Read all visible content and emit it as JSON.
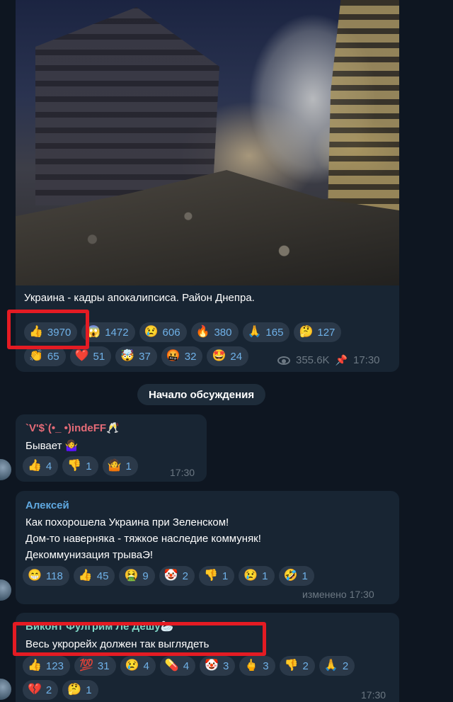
{
  "post": {
    "caption": "Украина - кадры апокалипсиса. Район Днепра.",
    "reactions": [
      {
        "emoji": "👍",
        "count": "3970"
      },
      {
        "emoji": "😱",
        "count": "1472"
      },
      {
        "emoji": "😢",
        "count": "606"
      },
      {
        "emoji": "🔥",
        "count": "380"
      },
      {
        "emoji": "🙏",
        "count": "165"
      },
      {
        "emoji": "🤔",
        "count": "127"
      },
      {
        "emoji": "👏",
        "count": "65"
      },
      {
        "emoji": "❤️",
        "count": "51"
      },
      {
        "emoji": "🤯",
        "count": "37"
      },
      {
        "emoji": "🤬",
        "count": "32"
      },
      {
        "emoji": "🤩",
        "count": "24"
      }
    ],
    "views": "355.6K",
    "time": "17:30"
  },
  "discussion_label": "Начало обсуждения",
  "comments": [
    {
      "name": "`V'$`(•_ •)indeFF🥂",
      "name_color": "#e56b77",
      "lines": [
        "Бывает 🤷‍♀️"
      ],
      "reactions": [
        {
          "emoji": "👍",
          "count": "4"
        },
        {
          "emoji": "👎",
          "count": "1"
        },
        {
          "emoji": "🤷",
          "count": "1"
        }
      ],
      "time": "17:30"
    },
    {
      "name": "Алексей",
      "name_color": "#5fa8e0",
      "lines": [
        "Как похорошела Украина при Зеленском!",
        "Дом-то наверняка - тяжкое наследие коммуняк!",
        "Декоммунизация трываЭ!"
      ],
      "reactions": [
        {
          "emoji": "😁",
          "count": "118"
        },
        {
          "emoji": "👍",
          "count": "45"
        },
        {
          "emoji": "🤮",
          "count": "9"
        },
        {
          "emoji": "🤡",
          "count": "2"
        },
        {
          "emoji": "👎",
          "count": "1"
        },
        {
          "emoji": "😢",
          "count": "1"
        },
        {
          "emoji": "🤣",
          "count": "1"
        }
      ],
      "time": "изменено 17:30"
    },
    {
      "name": "Виконт Фулгрим Ле Дешу🦢",
      "name_color": "#7fd3c4",
      "lines": [
        "Весь укрорейх должен так выглядеть"
      ],
      "reactions": [
        {
          "emoji": "👍",
          "count": "123"
        },
        {
          "emoji": "💯",
          "count": "31"
        },
        {
          "emoji": "😢",
          "count": "4"
        },
        {
          "emoji": "💊",
          "count": "4"
        },
        {
          "emoji": "🤡",
          "count": "3"
        },
        {
          "emoji": "🖕",
          "count": "3"
        },
        {
          "emoji": "👎",
          "count": "2"
        },
        {
          "emoji": "🙏",
          "count": "2"
        },
        {
          "emoji": "💔",
          "count": "2"
        },
        {
          "emoji": "🤔",
          "count": "1"
        }
      ],
      "time": "17:30"
    }
  ],
  "colors": {
    "background": "#0e1621",
    "bubble": "#182533",
    "reaction_chip": "#2b3949",
    "reaction_text": "#6fb1e8",
    "meta": "#6c7883",
    "highlight_box": "#e41b23"
  }
}
